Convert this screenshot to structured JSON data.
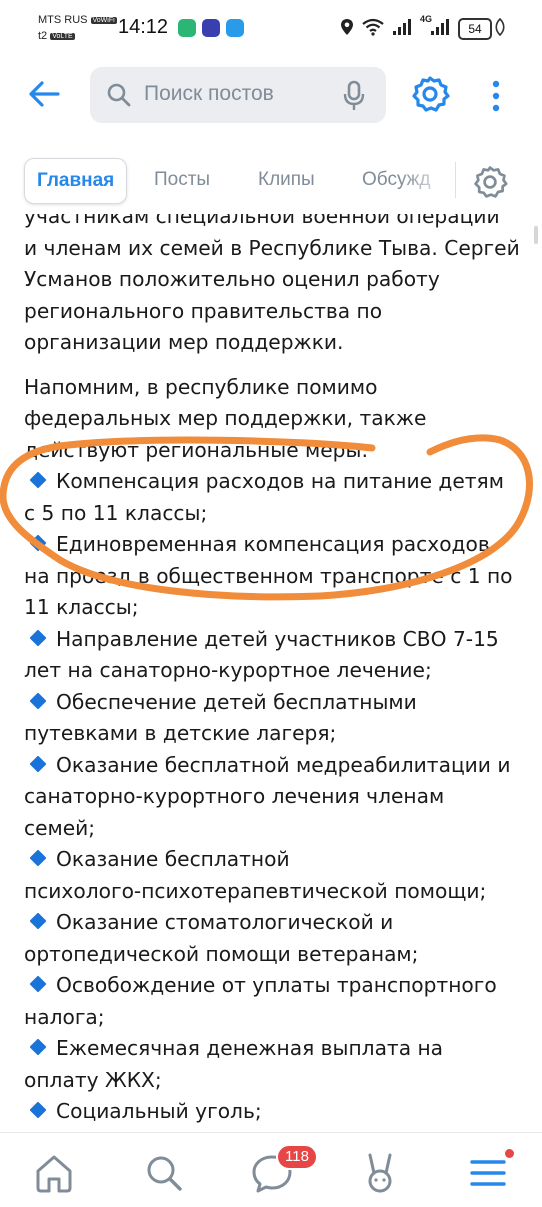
{
  "status_bar": {
    "carrier1": "MTS RUS",
    "carrier1_tag": "VoWiFi",
    "carrier2": "t2",
    "carrier2_tag": "VoLTE",
    "time": "14:12",
    "network": "4G",
    "battery": "54"
  },
  "header": {
    "search_placeholder": "Поиск постов"
  },
  "tabs": [
    {
      "label": "Главная",
      "active": true
    },
    {
      "label": "Посты",
      "active": false
    },
    {
      "label": "Клипы",
      "active": false
    },
    {
      "label": "Обсужд",
      "active": false
    }
  ],
  "post": {
    "intro_lines": [
      "участникам специальной военной операции",
      "и членам их семей в Республике Тыва. Сергей",
      "Усманов положительно оценил работу",
      "регионального правительства по",
      "организации мер поддержки."
    ],
    "para2_lines": [
      "Напомним, в республике помимо",
      "федеральных мер поддержки, также",
      "действуют региональные меры:"
    ],
    "measures": [
      [
        "Компенсация расходов на питание детям",
        "с 5 по 11 классы;"
      ],
      [
        "Единовременная компенсация расходов",
        "на проезд в общественном транспорте с 1 по",
        "11 классы;"
      ],
      [
        "Направление детей участников СВО 7-15",
        "лет на санаторно-курортное лечение;"
      ],
      [
        "Обеспечение детей бесплатными",
        "путевками в детские лагеря;"
      ],
      [
        "Оказание бесплатной медреабилитации и",
        "санаторно-курортного лечения членам",
        "семей;"
      ],
      [
        "Оказание бесплатной",
        "психолого-психотерапевтической помощи;"
      ],
      [
        "Оказание стоматологической и",
        "ортопедической помощи ветеранам;"
      ],
      [
        "Освобождение от уплаты транспортного",
        "налога;"
      ],
      [
        "Ежемесячная денежная выплата на",
        "оплату ЖКХ;"
      ],
      [
        "Социальный уголь;"
      ]
    ]
  },
  "bottom_nav": {
    "messages_badge": "118"
  },
  "colors": {
    "accent": "#2688eb",
    "badge": "#e64646",
    "annotation": "#f08c3a",
    "bullet": "#1a73d9"
  }
}
